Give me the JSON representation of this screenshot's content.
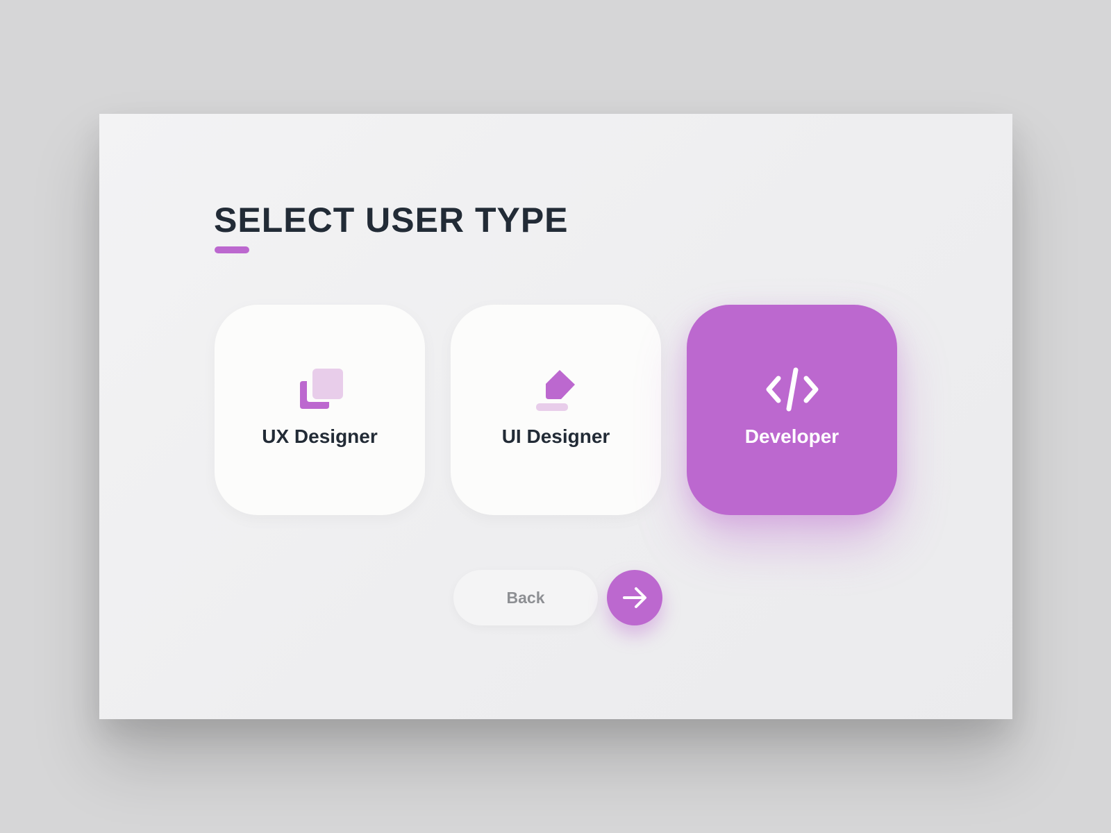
{
  "page": {
    "title": "SELECT USER TYPE"
  },
  "user_types": [
    {
      "label": "UX Designer",
      "icon": "layers-icon",
      "selected": false
    },
    {
      "label": "UI Designer",
      "icon": "pen-nib-icon",
      "selected": false
    },
    {
      "label": "Developer",
      "icon": "code-icon",
      "selected": true
    }
  ],
  "actions": {
    "back_label": "Back",
    "next_icon": "arrow-right-icon"
  },
  "colors": {
    "accent": "#bc68cf",
    "accent_light": "#e8cdea",
    "text_dark": "#222b36",
    "text_muted": "#8d8f93",
    "card_bg": "#fcfcfb",
    "panel_bg": "#f1f1f2",
    "page_bg": "#d6d6d7"
  }
}
